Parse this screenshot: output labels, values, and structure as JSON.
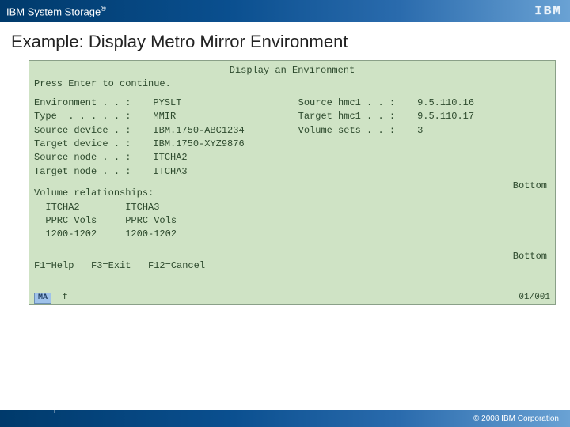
{
  "header": {
    "product": "IBM System Storage",
    "registered": "®",
    "logo_text": "IBM"
  },
  "slide": {
    "title": "Example: Display Metro Mirror Environment"
  },
  "terminal": {
    "screen_title": "Display an Environment",
    "prompt": "Press Enter to continue.",
    "left_labels": {
      "env": "Environment . . :",
      "type": "Type  . . . . . :",
      "srcdev": "Source device . :",
      "tgtdev": "Target device . :",
      "srcnode": "Source node . . :",
      "tgtnode": "Target node . . :"
    },
    "left_values": {
      "env": "PYSLT",
      "type": "MMIR",
      "srcdev": "IBM.1750-ABC1234",
      "tgtdev": "IBM.1750-XYZ9876",
      "srcnode": "ITCHA2",
      "tgtnode": "ITCHA3"
    },
    "right_labels": {
      "srchmc": "Source hmc1 . . :",
      "tgthmc": "Target hmc1 . . :",
      "volsets": "Volume sets . . :"
    },
    "right_values": {
      "srchmc": "9.5.110.16",
      "tgthmc": "9.5.110.17",
      "volsets": "3"
    },
    "volrel": {
      "heading": "Volume relationships:",
      "row1": "  ITCHA2        ITCHA3",
      "row2": "  PPRC Vols     PPRC Vols",
      "row3": "  1200-1202     1200-1202"
    },
    "bottom_marker1": "Bottom",
    "bottom_marker2": "Bottom",
    "fkeys": "F1=Help   F3=Exit   F12=Cancel",
    "status_left": "MA",
    "status_f": "f",
    "status_right": "01/001"
  },
  "footer": {
    "copyright": "© 2008 IBM Corporation"
  }
}
